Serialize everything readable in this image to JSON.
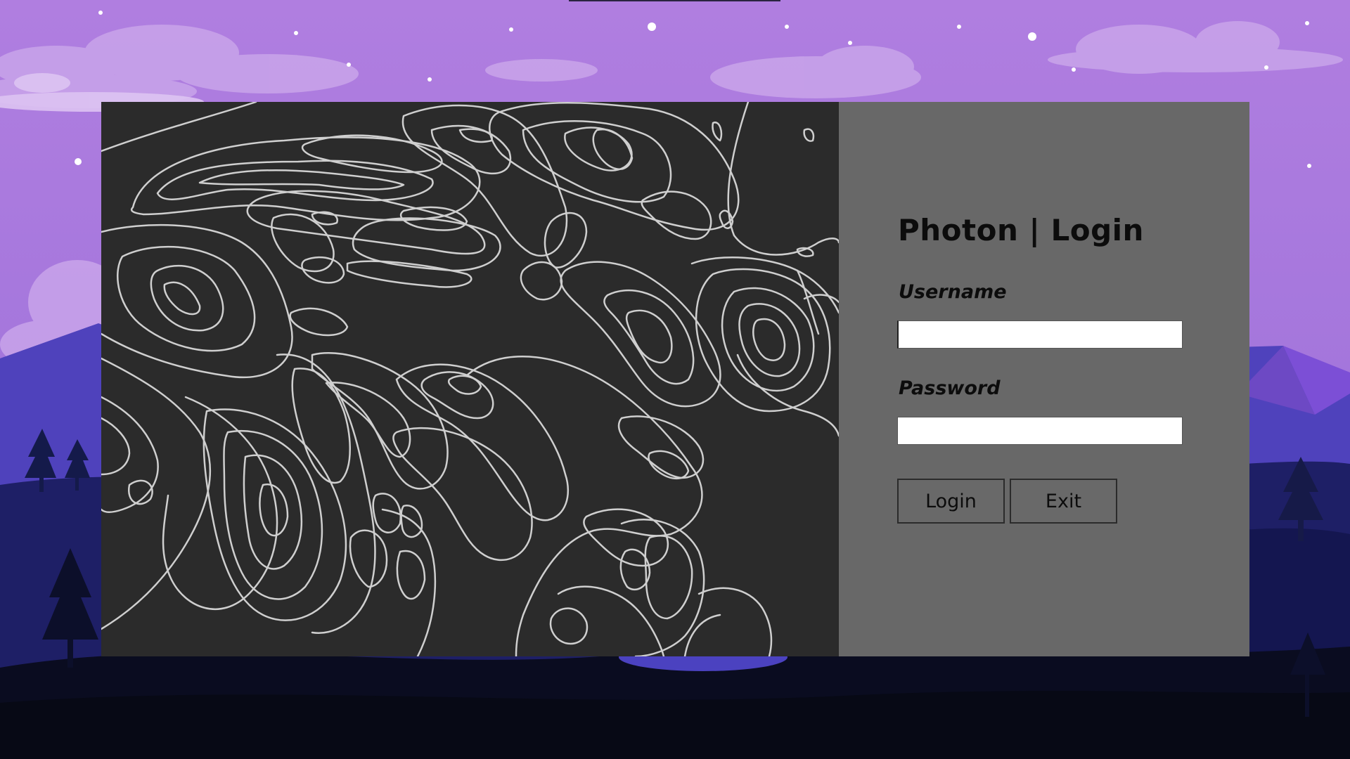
{
  "window": {
    "title": "Photon | Login"
  },
  "login_form": {
    "username_label": "Username",
    "username_value": "",
    "password_label": "Password",
    "password_value": "",
    "login_button": "Login",
    "exit_button": "Exit"
  },
  "colors": {
    "sky_top": "#b07ee0",
    "sky_bottom": "#9a6ad8",
    "mountain_back": "#4a3fb8",
    "mountain_mid": "#2c2a8a",
    "ground_dark": "#0d0f24",
    "art_panel_bg": "#2b2b2b",
    "art_lines": "#cfcfcf",
    "form_panel_bg": "#686868",
    "text": "#0c0c0c",
    "input_bg": "#ffffff"
  },
  "background": {
    "description_icon": "night-mountain-landscape-icon"
  },
  "decoration": {
    "art_icon": "topographic-contour-icon"
  }
}
